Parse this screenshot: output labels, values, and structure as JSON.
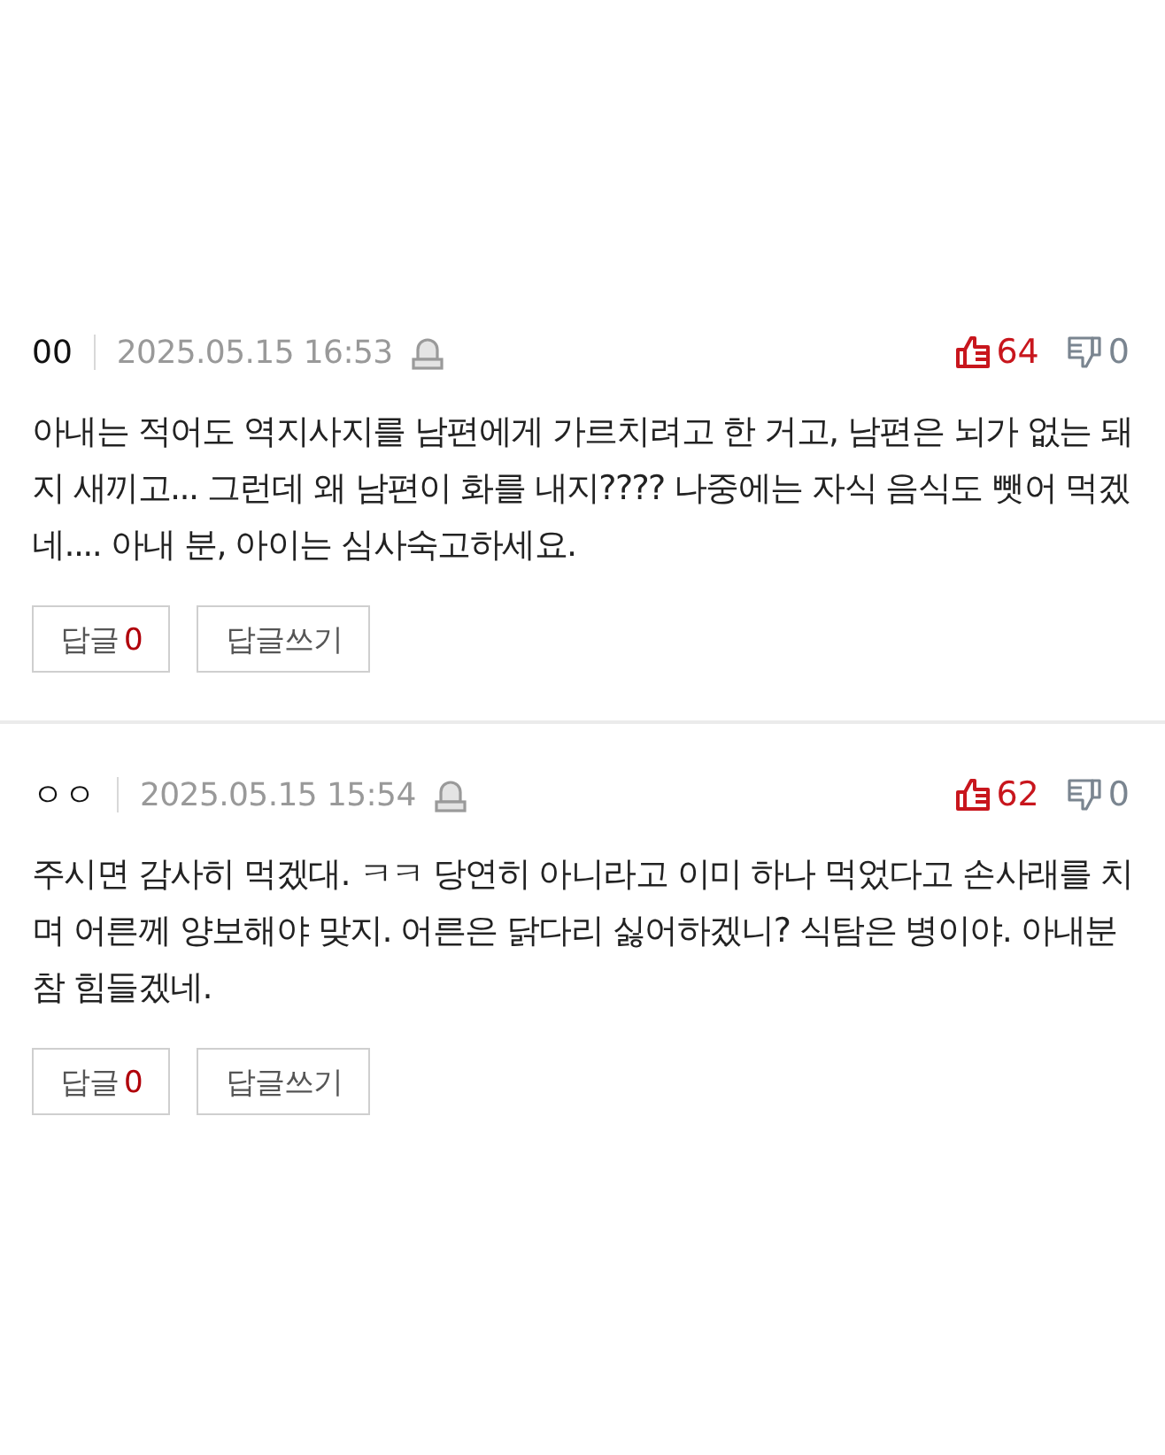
{
  "comments": [
    {
      "author": "00",
      "date": "2025.05.15 16:53",
      "likes": "64",
      "dislikes": "0",
      "text": "아내는 적어도 역지사지를 남편에게 가르치려고 한 거고, 남편은 뇌가 없는 돼지 새끼고... 그런데 왜 남편이 화를 내지???? 나중에는 자식 음식도 뺏어 먹겠네.... 아내 분, 아이는 심사숙고하세요.",
      "reply_label": "답글",
      "reply_count": "0",
      "write_reply": "답글쓰기"
    },
    {
      "author": "ㅇㅇ",
      "date": "2025.05.15 15:54",
      "likes": "62",
      "dislikes": "0",
      "text": "주시면 감사히 먹겠대. ㅋㅋ 당연히 아니라고 이미 하나 먹었다고 손사래를 치며 어른께 양보해야 맞지. 어른은 닭다리 싫어하겠니? 식탐은 병이야. 아내분 참 힘들겠네.",
      "reply_label": "답글",
      "reply_count": "0",
      "write_reply": "답글쓰기"
    }
  ]
}
